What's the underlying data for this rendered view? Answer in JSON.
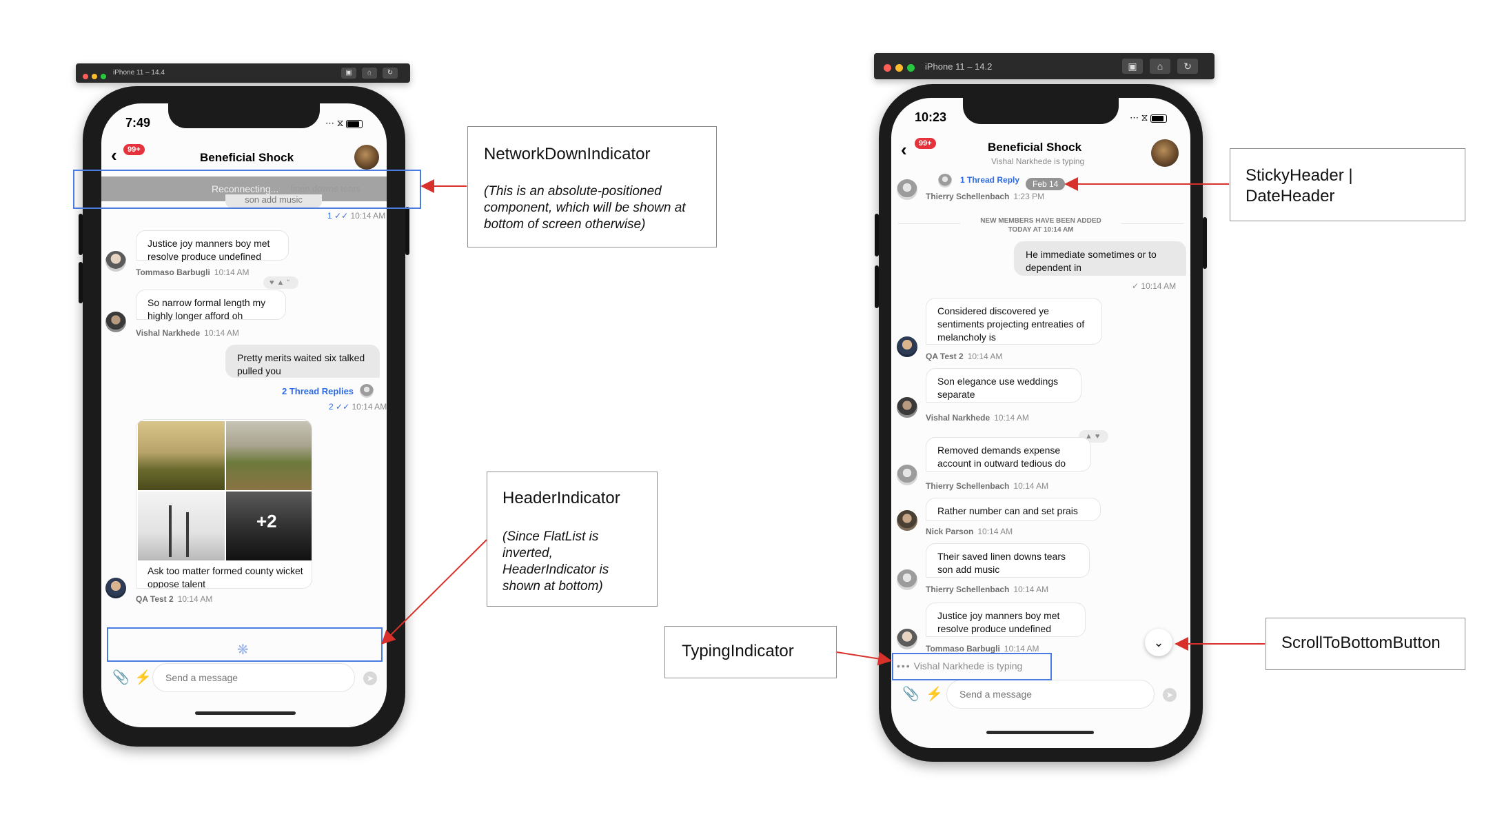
{
  "left_device": {
    "simulator_title": "iPhone 11 – 14.4",
    "status_time": "7:49",
    "channel": {
      "title": "Beneficial Shock",
      "unread_badge": "99+"
    },
    "reconnecting_text": "Reconnecting...",
    "faded_message": {
      "text": "son add music",
      "behind_text": "linen downs tears",
      "receipt": "1",
      "time": "10:14 AM"
    },
    "messages": [
      {
        "text": "Justice joy manners boy met resolve produce undefined",
        "author": "Tommaso Barbugli",
        "time": "10:14 AM"
      },
      {
        "text": "So narrow formal length my highly longer afford oh",
        "author": "Vishal Narkhede",
        "time": "10:14 AM"
      },
      {
        "text": "Pretty merits waited six talked pulled you",
        "thread_replies": "2 Thread Replies",
        "receipt": "2",
        "time": "10:14 AM"
      },
      {
        "text": "Ask too matter formed county wicket oppose talent",
        "more_images": "+2",
        "author": "QA Test 2",
        "time": "10:14 AM"
      }
    ],
    "input_placeholder": "Send a message"
  },
  "right_device": {
    "simulator_title": "iPhone 11 – 14.2",
    "status_time": "10:23",
    "channel": {
      "title": "Beneficial Shock",
      "subtitle": "Vishal Narkhede is typing",
      "unread_badge": "99+"
    },
    "sticky_header": {
      "thread_link": "1 Thread Reply",
      "date": "Feb 14",
      "author": "Thierry Schellenbach",
      "time": "1:23 PM"
    },
    "system_message": {
      "line1": "NEW MEMBERS HAVE BEEN ADDED",
      "line2": "TODAY AT 10:14 AM"
    },
    "messages": [
      {
        "text": "He immediate sometimes or to dependent in",
        "time": "10:14 AM"
      },
      {
        "text": "Considered discovered ye sentiments projecting entreaties of melancholy is",
        "author": "QA Test 2",
        "time": "10:14 AM"
      },
      {
        "text": "Son elegance use weddings separate",
        "author": "Vishal Narkhede",
        "time": "10:14 AM"
      },
      {
        "text": "Removed demands expense account in outward tedious do",
        "author": "Thierry Schellenbach",
        "time": "10:14 AM"
      },
      {
        "text": "Rather number can and set prais",
        "author": "Nick Parson",
        "time": "10:14 AM"
      },
      {
        "text": "Their saved linen downs tears son add music",
        "author": "Thierry Schellenbach",
        "time": "10:14 AM"
      },
      {
        "text": "Justice joy manners boy met resolve produce undefined",
        "author": "Tommaso Barbugli",
        "time": "10:14 AM"
      }
    ],
    "typing_text": "Vishal Narkhede is typing",
    "input_placeholder": "Send a message"
  },
  "annotations": {
    "network": {
      "title": "NetworkDownIndicator",
      "note": "(This is an absolute-positioned component, which will be shown at bottom of screen otherwise)"
    },
    "header": {
      "title": "HeaderIndicator",
      "note": "(Since FlatList is inverted, HeaderIndicator is shown at bottom)"
    },
    "sticky": {
      "title": "StickyHeader | DateHeader"
    },
    "typing": {
      "title": "TypingIndicator"
    },
    "scroll": {
      "title": "ScrollToBottomButton"
    }
  },
  "colors": {
    "accent": "#2d6be5",
    "badge": "#e5323b",
    "highlight": "#4a7be0",
    "arrow": "#d8302a"
  }
}
